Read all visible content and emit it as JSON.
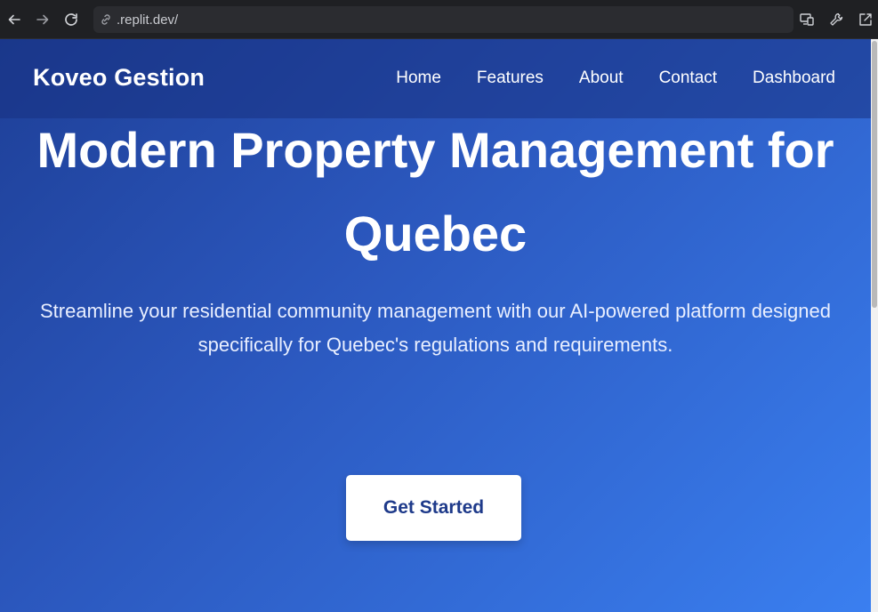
{
  "browser": {
    "url": ".replit.dev/"
  },
  "nav": {
    "brand": "Koveo Gestion",
    "items": [
      {
        "label": "Home"
      },
      {
        "label": "Features"
      },
      {
        "label": "About"
      },
      {
        "label": "Contact"
      },
      {
        "label": "Dashboard"
      }
    ]
  },
  "hero": {
    "title": "Modern Property Management for Quebec",
    "subtitle": "Streamline your residential community management with our AI-powered platform designed specifically for Quebec's regulations and requirements.",
    "cta_label": "Get Started"
  },
  "colors": {
    "accent": "#1e3a8a",
    "gradient_start": "#1e3f97",
    "gradient_end": "#3a7ff0"
  }
}
